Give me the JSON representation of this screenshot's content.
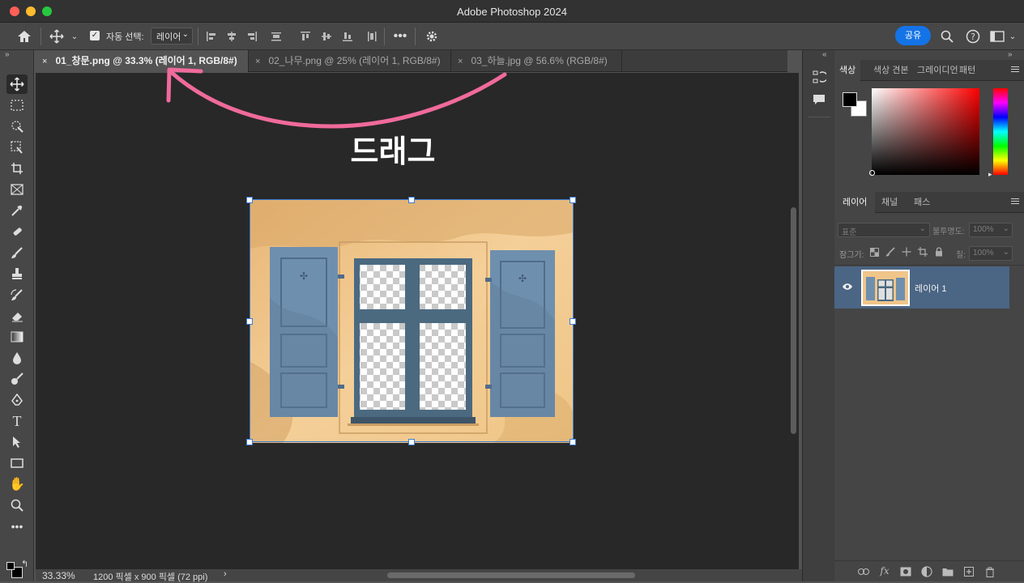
{
  "window": {
    "title": "Adobe Photoshop 2024"
  },
  "options_bar": {
    "auto_select_label": "자동 선택:",
    "auto_select_checked": true,
    "auto_select_target": "레이어",
    "share_label": "공유"
  },
  "tabs": [
    {
      "label": "01_창문.png @ 33.3% (레이어 1, RGB/8#)",
      "active": true
    },
    {
      "label": "02_나무.png @ 25% (레이어 1, RGB/8#)",
      "active": false
    },
    {
      "label": "03_하늘.jpg @ 56.6% (RGB/8#)",
      "active": false
    }
  ],
  "annotation": {
    "text": "드래그",
    "arrow_color": "#f06a9b"
  },
  "status": {
    "zoom": "33.33%",
    "doc_info": "1200 픽셀 x 900 픽셀 (72 ppi)"
  },
  "color_panel": {
    "tabs": [
      "색상",
      "색상 견본",
      "그레이디언",
      "패턴"
    ],
    "foreground": "#000000",
    "background": "#ffffff"
  },
  "layers_panel": {
    "tabs": [
      "레이어",
      "채널",
      "패스"
    ],
    "blend_mode": "표준",
    "opacity_label": "불투명도:",
    "opacity_value": "100%",
    "lock_label": "잠그기:",
    "fill_label": "칠:",
    "fill_value": "100%",
    "layers": [
      {
        "name": "레이어 1",
        "visible": true,
        "selected": true
      }
    ]
  },
  "colors": {
    "accent": "#1473e6",
    "selected_layer": "#4b6584",
    "canvas_bg": "#282828",
    "wall": "#f2c98d",
    "shutter": "#6d8fae"
  }
}
